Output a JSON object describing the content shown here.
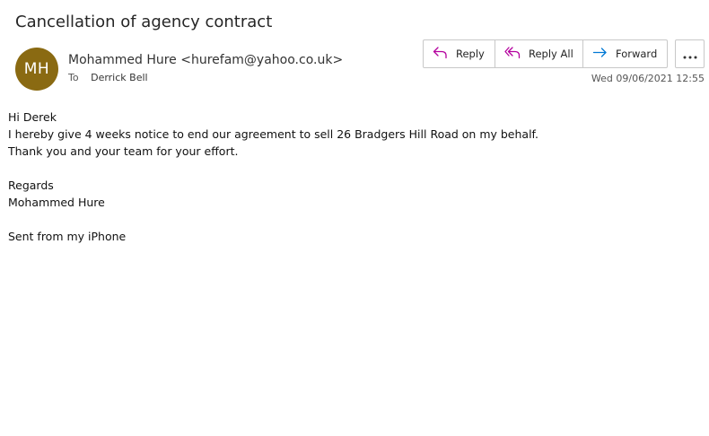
{
  "email": {
    "subject": "Cancellation of agency contract",
    "avatar_initials": "MH",
    "avatar_color": "#8a6a12",
    "sender": "Mohammed Hure <hurefam@yahoo.co.uk>",
    "to_label": "To",
    "to_name": "Derrick Bell",
    "timestamp": "Wed 09/06/2021 12:55"
  },
  "actions": {
    "reply": "Reply",
    "reply_all": "Reply All",
    "forward": "Forward",
    "more_icon": "more-icon",
    "accent_reply": "#b4009e",
    "accent_forward": "#0078d4"
  },
  "body": {
    "lines": [
      "Hi Derek",
      "I hereby give 4 weeks notice to end our agreement to sell 26 Bradgers Hill Road on my behalf.",
      "Thank you and your team for your effort.",
      "",
      "Regards",
      "Mohammed Hure",
      "",
      "Sent from my iPhone"
    ]
  }
}
